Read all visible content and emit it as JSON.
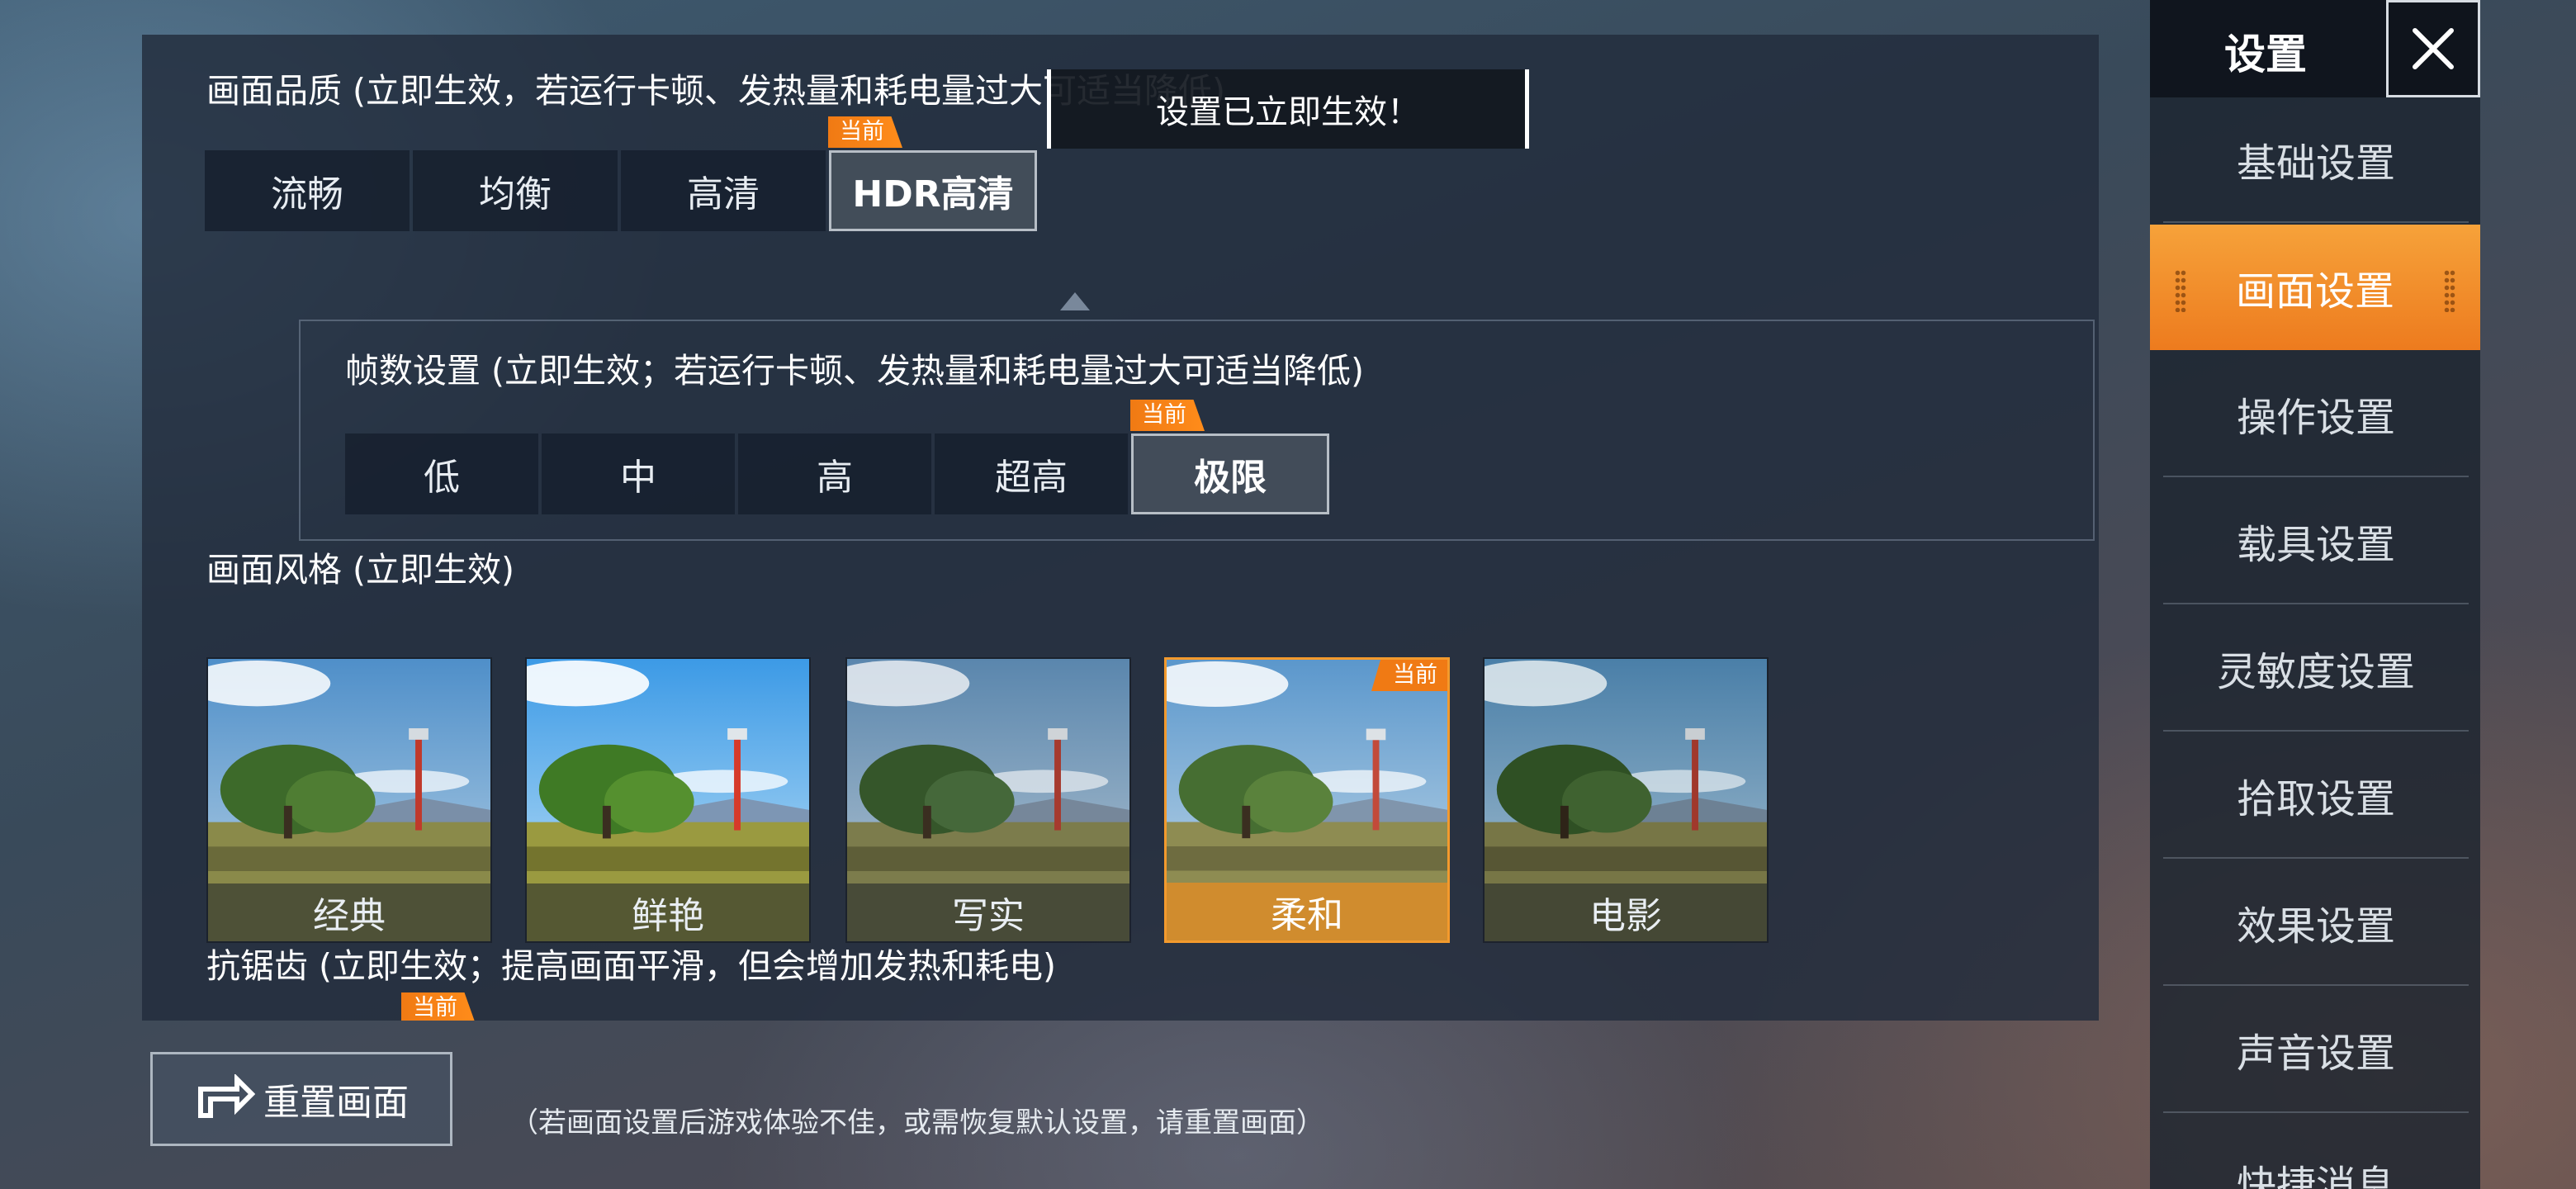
{
  "graphics_quality": {
    "title": "画面品质 (立即生效，若运行卡顿、发热量和耗电量过大可适当降低)",
    "options": [
      "流畅",
      "均衡",
      "高清",
      "HDR高清"
    ],
    "current_tag": "当前"
  },
  "frame_rate": {
    "title": "帧数设置 (立即生效；若运行卡顿、发热量和耗电量过大可适当降低)",
    "options": [
      "低",
      "中",
      "高",
      "超高",
      "极限"
    ],
    "current_tag": "当前"
  },
  "style": {
    "title": "画面风格 (立即生效)",
    "options": [
      "经典",
      "鲜艳",
      "写实",
      "柔和",
      "电影"
    ],
    "current_tag": "当前"
  },
  "anti_aliasing": {
    "title": "抗锯齿 (立即生效；提高画面平滑，但会增加发热和耗电)",
    "current_tag": "当前"
  },
  "toast": "设置已立即生效！",
  "reset": {
    "label": "重置画面",
    "note": "（若画面设置后游戏体验不佳，或需恢复默认设置，请重置画面）"
  },
  "sidebar": {
    "title": "设置",
    "items": [
      "基础设置",
      "画面设置",
      "操作设置",
      "载具设置",
      "灵敏度设置",
      "拾取设置",
      "效果设置",
      "声音设置",
      "快捷消息"
    ]
  },
  "colors": {
    "accent": "#f07a14",
    "active_nav": "#ed7b1e",
    "panel": "#222c3c"
  }
}
